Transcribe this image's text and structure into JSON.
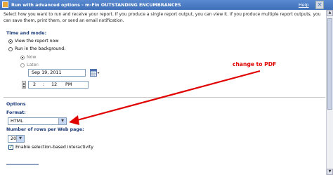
{
  "window": {
    "title": "Run with advanced options - m-Fin OUTSTANDING ENCUMBRANCES",
    "help_label": "Help",
    "close_symbol": "×"
  },
  "description": "Select how you want to run and receive your report. If you produce a single report output, you can view it. If you produce multiple report outputs, you can save them, print them, or send an email notification.",
  "time_mode": {
    "heading": "Time and mode:",
    "view_now": "View the report now",
    "run_background": "Run in the background:",
    "now": "Now",
    "later": "Later:",
    "date": "Sep 19, 2011",
    "hour": "2",
    "separator": ":",
    "minute": "12",
    "ampm": "PM"
  },
  "options": {
    "heading": "Options",
    "format_label": "Format:",
    "format_value": "HTML",
    "rows_label": "Number of rows per Web page:",
    "rows_value": "20",
    "interactivity_label": "Enable selection-based interactivity"
  },
  "annotation": {
    "text": "change to PDF",
    "color": "#e00000"
  },
  "icons": {
    "calendar": "calendar-icon",
    "dropdown": "chevron-down-icon"
  }
}
